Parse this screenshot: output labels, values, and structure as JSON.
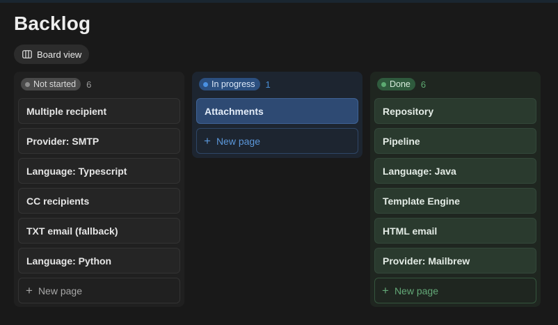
{
  "page": {
    "title": "Backlog",
    "view_button": {
      "label": "Board view",
      "icon": "board-columns-icon"
    }
  },
  "columns": [
    {
      "status": "Not started",
      "count": "6",
      "color": "#8d8d8d",
      "cards": [
        "Multiple recipient",
        "Provider: SMTP",
        "Language: Typescript",
        "CC recipients",
        "TXT email (fallback)",
        "Language: Python"
      ],
      "new_page_label": "New page"
    },
    {
      "status": "In progress",
      "count": "1",
      "color": "#4a91e2",
      "cards": [
        "Attachments"
      ],
      "new_page_label": "New page"
    },
    {
      "status": "Done",
      "count": "6",
      "color": "#5cab72",
      "cards": [
        "Repository",
        "Pipeline",
        "Language: Java",
        "Template Engine",
        "HTML email",
        "Provider: Mailbrew"
      ],
      "new_page_label": "New page"
    }
  ]
}
